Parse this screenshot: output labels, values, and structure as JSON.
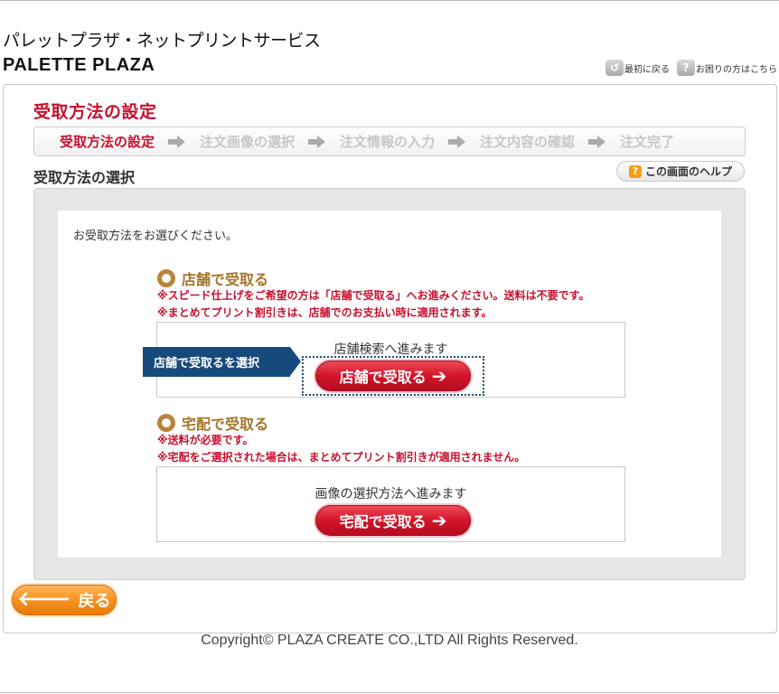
{
  "header": {
    "brand_jp": "パレットプラザ・ネットプリントサービス",
    "brand_en": "PALETTE PLAZA",
    "links": [
      {
        "icon": "back-to-start-icon",
        "label": "最初に戻る"
      },
      {
        "icon": "question-icon",
        "label": "お困りの方はこちら"
      }
    ]
  },
  "page": {
    "title": "受取方法の設定",
    "steps": [
      "受取方法の設定",
      "注文画像の選択",
      "注文情報の入力",
      "注文内容の確認",
      "注文完了"
    ],
    "active_step": 0,
    "section_title": "受取方法の選択",
    "help_label": "この画面のヘルプ"
  },
  "content": {
    "instruction": "お受取方法をお選びください。",
    "store_option": {
      "heading": "店舗で受取る",
      "notes": [
        "※スピード仕上げをご希望の方は「店舗で受取る」へお進みください。送料は不要です。",
        "※まとめてプリント割引きは、店舗でのお支払い時に適用されます。"
      ],
      "caption": "店舗検索へ進みます",
      "button_label": "店舗で受取る",
      "tag_label": "店舗で受取るを選択"
    },
    "delivery_option": {
      "heading": "宅配で受取る",
      "notes": [
        "※送料が必要です。",
        "※宅配をご選択された場合は、まとめてプリント割引きが適用されません。"
      ],
      "caption": "画像の選択方法へ進みます",
      "button_label": "宅配で受取る"
    }
  },
  "footer": {
    "back_label": "戻る",
    "copyright": "Copyright© PLAZA CREATE CO.,LTD All Rights Reserved."
  },
  "colors": {
    "accent_red": "#c8102e",
    "option_brown": "#a5742a",
    "tag_blue": "#174a7c",
    "back_orange": "#f7931e"
  }
}
